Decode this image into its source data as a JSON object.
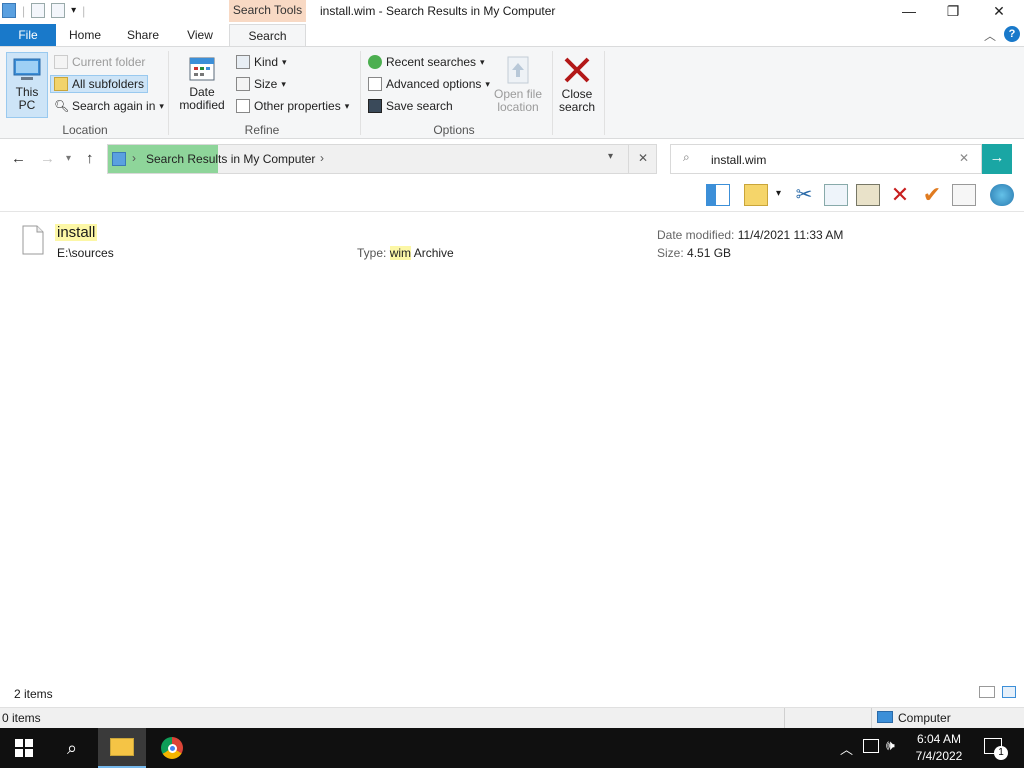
{
  "window": {
    "title": "install.wim - Search Results in My Computer",
    "context_tab": "Search Tools",
    "controls": {
      "minimize": "—",
      "restore": "❐",
      "close": "✕"
    }
  },
  "ribbon_tabs": [
    "File",
    "Home",
    "Share",
    "View",
    "Search"
  ],
  "ribbon": {
    "location": {
      "label": "Location",
      "this_pc": "This PC",
      "current_folder": "Current folder",
      "all_subfolders": "All subfolders",
      "search_again": "Search again in"
    },
    "refine": {
      "label": "Refine",
      "date_modified": "Date modified",
      "kind": "Kind",
      "size": "Size",
      "other_properties": "Other properties"
    },
    "options": {
      "label": "Options",
      "recent_searches": "Recent searches",
      "advanced_options": "Advanced options",
      "save_search": "Save search",
      "open_file_location": "Open file location"
    },
    "close_search": "Close search"
  },
  "address": {
    "path": "Search Results in My Computer",
    "search_value": "install.wim",
    "search_progress": 0.2
  },
  "results": [
    {
      "name": "install",
      "path": "E:\\sources",
      "type_label": "Type:",
      "type_ext": "wim",
      "type_rest": "Archive",
      "date_label": "Date modified:",
      "date_value": "11/4/2021 11:33 AM",
      "size_label": "Size:",
      "size_value": "4.51 GB"
    }
  ],
  "status": {
    "item_count": "2 items",
    "footer_items": "0 items",
    "location": "Computer"
  },
  "taskbar": {
    "time": "6:04 AM",
    "date": "7/4/2022",
    "notification_count": "1"
  }
}
